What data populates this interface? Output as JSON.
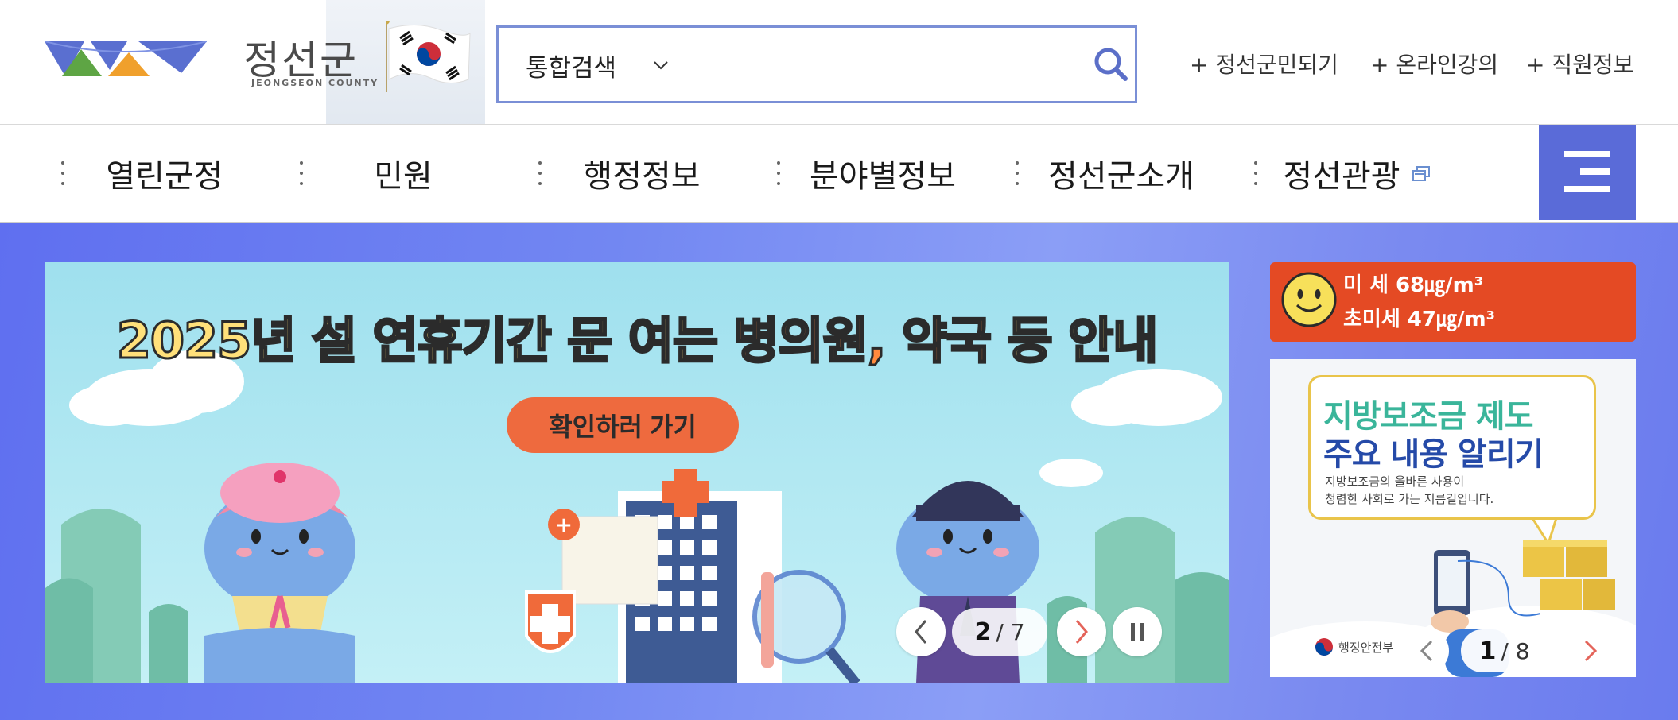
{
  "site": {
    "name": "정선군",
    "name_en": "JEONGSEON COUNTY"
  },
  "search": {
    "category": "통합검색",
    "placeholder": ""
  },
  "util_links": [
    "+ 정선군민되기",
    "+ 온라인강의",
    "+ 직원정보"
  ],
  "gnb": [
    "열린군정",
    "민원",
    "행정정보",
    "분야별정보",
    "정선군소개",
    "정선관광"
  ],
  "main_banner": {
    "headline_a": "2025년 설 연휴기간 문 여는 ",
    "headline_b": "병의원, 약국",
    "headline_c": " 등 안내",
    "button": "확인하러 가기",
    "current": "2",
    "total": "/ 7"
  },
  "air_quality": {
    "pm10": "미 세 68㎍/m³",
    "pm25": "초미세 47㎍/m³"
  },
  "side_banner": {
    "title_1": "지방보조금 제도",
    "title_2": "주요 내용 알리기",
    "desc_1": "지방보조금의 올바른 사용이",
    "desc_2": "청렴한 사회로 가는 지름길입니다.",
    "ministry": "행정안전부",
    "current": "1",
    "total": "/ 8"
  },
  "colors": {
    "nav_button": "#5a6bd8",
    "search_border": "#7a8fd6",
    "air_bg": "#e44a24",
    "banner_sky": "#bfe9f5"
  }
}
